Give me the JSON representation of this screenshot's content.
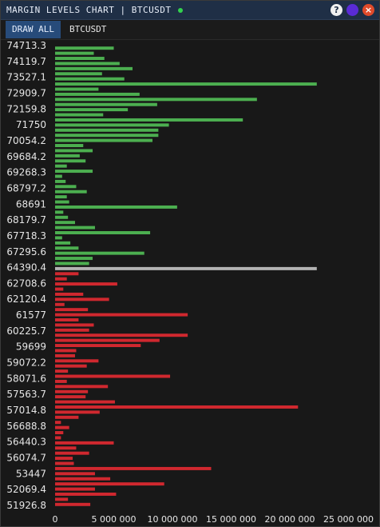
{
  "window": {
    "title": "MARGIN LEVELS CHART | BTCUSDT",
    "status_color": "#33d24e",
    "help_label": "?",
    "close_label": "×"
  },
  "toolbar": {
    "draw_all_label": "DRAW ALL",
    "symbol_tab_label": "BTCUSDT"
  },
  "chart_data": {
    "type": "bar",
    "orientation": "horizontal",
    "y_labels": [
      "74713.3",
      "74119.7",
      "73527.1",
      "72909.7",
      "72159.8",
      "71750",
      "70054.2",
      "69684.2",
      "69268.3",
      "68797.2",
      "68691",
      "68179.7",
      "67718.3",
      "67295.6",
      "64390.4",
      "62708.6",
      "62120.4",
      "61577",
      "60225.7",
      "59699",
      "59072.2",
      "58071.6",
      "57563.7",
      "57014.8",
      "56688.8",
      "56440.3",
      "56074.7",
      "53447",
      "52069.4",
      "51926.8"
    ],
    "x_ticks": [
      "0",
      "5 000 000",
      "10 000 000",
      "15 000 000",
      "20 000 000",
      "25 000 000"
    ],
    "xlim": [
      0,
      25000000
    ],
    "colors": {
      "long": "#4caf50",
      "mid": "#b3b3b3",
      "short": "#d0282f"
    },
    "values_long": [
      5000000,
      3300000,
      4200000,
      5500000,
      6600000,
      4000000,
      5900000,
      22300000,
      3700000,
      7200000,
      17200000,
      8700000,
      6200000,
      4100000,
      16000000,
      9700000,
      8800000,
      8800000,
      8300000,
      2400000,
      3200000,
      2100000,
      2600000,
      1000000,
      3200000,
      600000,
      900000,
      1800000,
      2700000,
      1000000,
      1200000,
      10400000,
      700000,
      1100000,
      1700000,
      3400000,
      8100000,
      600000,
      1300000,
      2000000,
      7600000,
      3200000,
      2900000
    ],
    "value_mid": 22300000,
    "values_short": [
      2000000,
      1000000,
      5300000,
      700000,
      2400000,
      4600000,
      800000,
      2800000,
      11300000,
      2000000,
      3300000,
      2900000,
      11300000,
      8900000,
      7300000,
      1800000,
      1700000,
      3700000,
      2700000,
      1100000,
      9800000,
      1000000,
      4500000,
      2800000,
      2600000,
      5100000,
      20700000,
      3800000,
      2000000,
      500000,
      1200000,
      700000,
      500000,
      5000000,
      1800000,
      2900000,
      1500000,
      1600000,
      13300000,
      3400000,
      4700000,
      9300000,
      3400000,
      5200000,
      1100000,
      3000000
    ]
  }
}
